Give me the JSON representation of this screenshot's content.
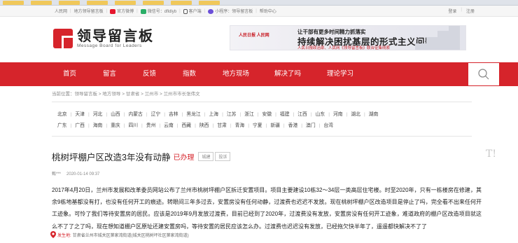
{
  "topbar": {
    "people_net": "人民网",
    "leader_site": "地方领导留言板",
    "weibo": "官方微博",
    "wechat": "微信号：dfldlyb",
    "client": "客户端",
    "miniprogram": "小程序：领导留言板",
    "help": "帮助中心",
    "login": "登录",
    "register": "注册"
  },
  "logo": {
    "cn": "领导留言板",
    "en": "Message Board for Leaders"
  },
  "banner": {
    "media": "人民日报 人民网",
    "line1": "让干部有更多时间精力抓落实",
    "line2": "持续解决困扰基层的形式主义问题",
    "line3": "人民日报政治部、人民网《领导留言板》联合征集线索"
  },
  "nav": {
    "items": [
      "首页",
      "留言",
      "反馈",
      "指数",
      "地方现场",
      "解决了吗",
      "理论学习"
    ]
  },
  "breadcrumb": "当前位置：领导留言板 > 地方领导 > 甘肃省 > 兰州市 > 兰州市市长张伟文",
  "regions": {
    "row1": [
      "北京",
      "天津",
      "河北",
      "山西",
      "内蒙古",
      "辽宁",
      "吉林",
      "黑龙江",
      "上海",
      "江苏",
      "浙江",
      "安徽",
      "福建",
      "江西",
      "山东",
      "河南",
      "湖北",
      "湖南"
    ],
    "row2": [
      "广东",
      "广西",
      "海南",
      "重庆",
      "四川",
      "贵州",
      "云南",
      "西藏",
      "陕西",
      "甘肃",
      "青海",
      "宁夏",
      "新疆",
      "香港",
      "澳门",
      "台湾"
    ]
  },
  "message": {
    "title": "桃树坪棚户区改造3年没有动静",
    "status": "已办理",
    "tag1": "城建",
    "tag2": "投诉",
    "author": "甄***",
    "time": "2020-01-14 09:37",
    "content": "2017年4月20日，兰州市发展和改革委员网站公布了兰州市桃树坪棚户区拆迁安置项目。项目主要建设10栋32～34层一类高层住宅楼。时至2020年，只有一栋楼房在修建，其余9栋地基都没有打，也没有任何开工的痕迹。转眼间三年多过去，安置房没有任何动静，过渡费也迟迟不发放。现在桃树坪棚户区改造项目是停止了吗，完全看不出来任何开工迹象。可怜了我们等待安置房的居民。应该是2019年9月发放过渡费，目前已经到了2020年，过渡费没有发放，安置房没有任何开工迹象，难道政府的棚户区改造项目就这么不了了之了吗，现在想知道棚户区原址还建安置房吗，等待安置的居民应该怎么办。过渡费也迟迟没有发放，已经拖欠快半年了，遥遥都快解决不了了",
    "location_label": "发生地:",
    "location": "甘肃省兰州市城关区第家湾街道(城关区桃树坪社区第家湾街道)"
  },
  "colors": {
    "brand_red": "#d6242b"
  }
}
